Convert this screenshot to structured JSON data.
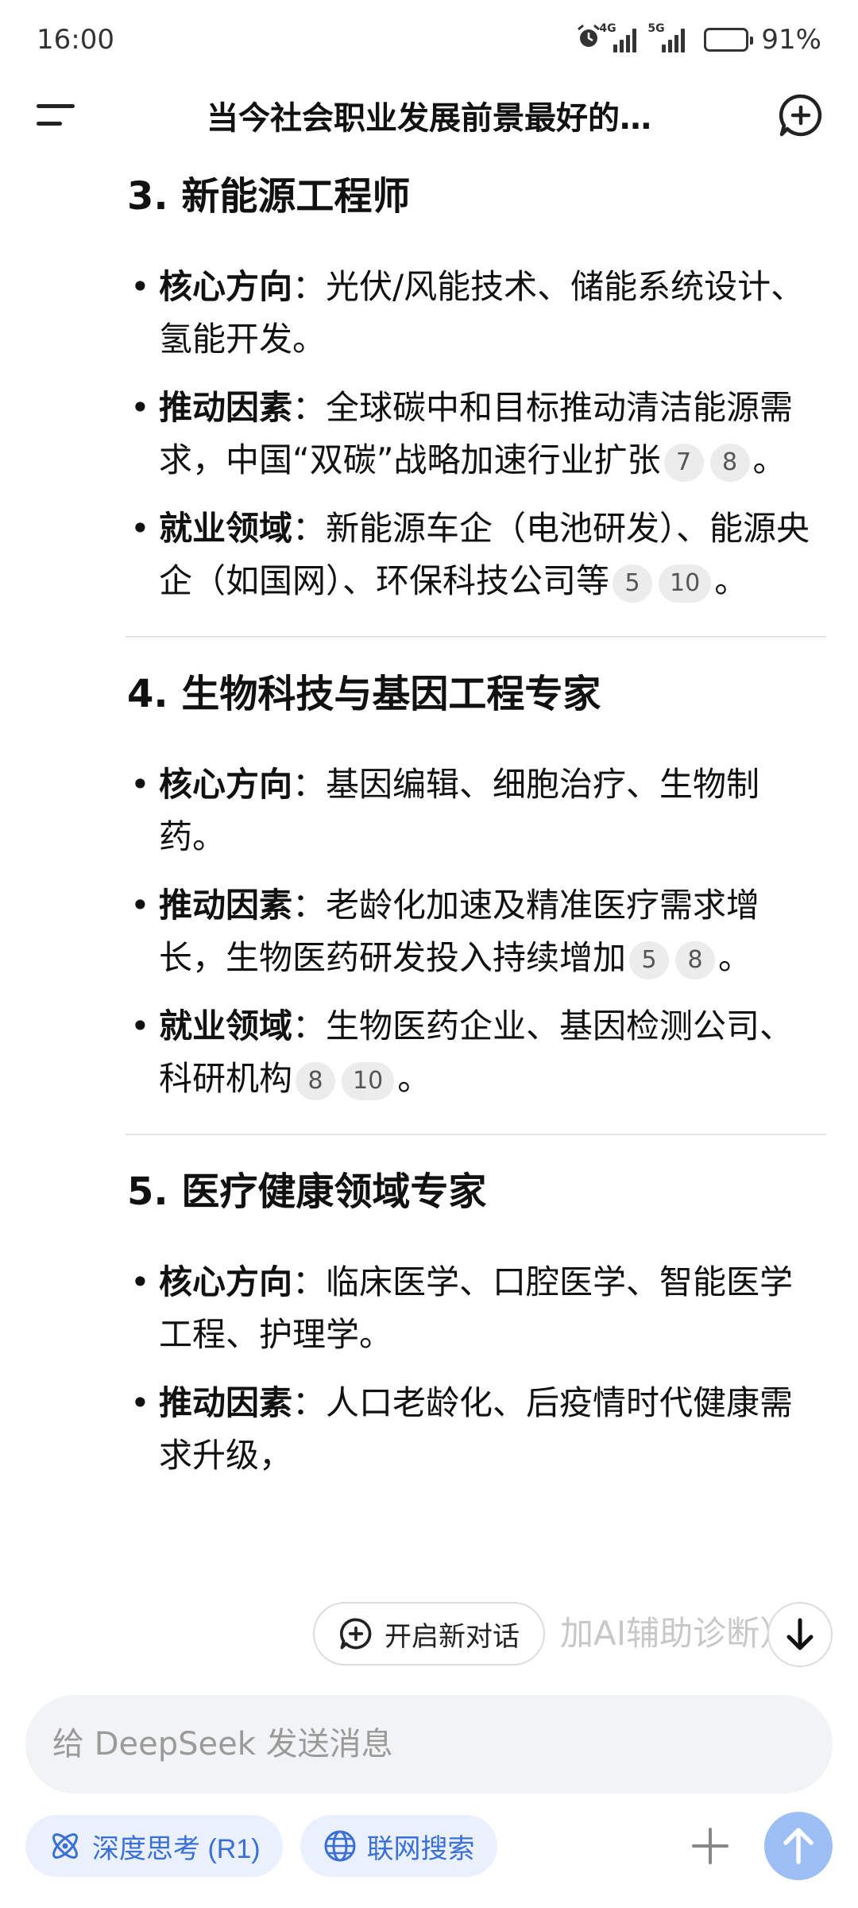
{
  "status_bar": {
    "time": "16:00",
    "network_1": "4G",
    "network_2": "5G",
    "battery_percent": "91%",
    "battery_level": 0.91
  },
  "header": {
    "title": "当今社会职业发展前景最好的…"
  },
  "sections": [
    {
      "title": "3. 新能源工程师",
      "points": [
        {
          "label": "核心方向",
          "sep": "：",
          "text": "光伏/风能技术、储能系统设计、氢能开发。",
          "cites": [],
          "end": ""
        },
        {
          "label": "推动因素",
          "sep": "：",
          "text": "全球碳中和目标推动清洁能源需求，中国“双碳”战略加速行业扩张",
          "cites": [
            "7",
            "8"
          ],
          "end": "。"
        },
        {
          "label": "就业领域",
          "sep": "：",
          "text": "新能源车企（电池研发）、能源央企（如国网）、环保科技公司等",
          "cites": [
            "5",
            "10"
          ],
          "end": "。"
        }
      ]
    },
    {
      "title": "4. 生物科技与基因工程专家",
      "points": [
        {
          "label": "核心方向",
          "sep": "：",
          "text": "基因编辑、细胞治疗、生物制药。",
          "cites": [],
          "end": ""
        },
        {
          "label": "推动因素",
          "sep": "：",
          "text": "老龄化加速及精准医疗需求增长，生物医药研发投入持续增加",
          "cites": [
            "5",
            "8"
          ],
          "end": "。"
        },
        {
          "label": "就业领域",
          "sep": "：",
          "text": "生物医药企业、基因检测公司、科研机构",
          "cites": [
            "8",
            "10"
          ],
          "end": "。"
        }
      ]
    },
    {
      "title": "5. 医疗健康领域专家",
      "points": [
        {
          "label": "核心方向",
          "sep": "：",
          "text": "临床医学、口腔医学、智能医学工程、护理学。",
          "cites": [],
          "end": ""
        },
        {
          "label": "推动因素",
          "sep": "：",
          "text": "人口老龄化、后疫情时代健康需求升级，",
          "cites": [],
          "end": ""
        }
      ]
    }
  ],
  "floating": {
    "new_chat_label": "开启新对话",
    "partial_text_behind": "加AI辅助诊断）"
  },
  "composer": {
    "placeholder": "给 DeepSeek 发送消息",
    "deep_think_label": "深度思考 (R1)",
    "web_search_label": "联网搜索"
  },
  "colors": {
    "accent": "#3a6fd8",
    "chip_bg": "#eaf1fd",
    "send_btn": "#9dbdf5"
  },
  "icons": [
    "menu-icon",
    "new-chat-icon",
    "alarm-icon",
    "atom-icon",
    "globe-icon",
    "plus-icon",
    "arrow-up-icon",
    "arrow-down-icon"
  ]
}
